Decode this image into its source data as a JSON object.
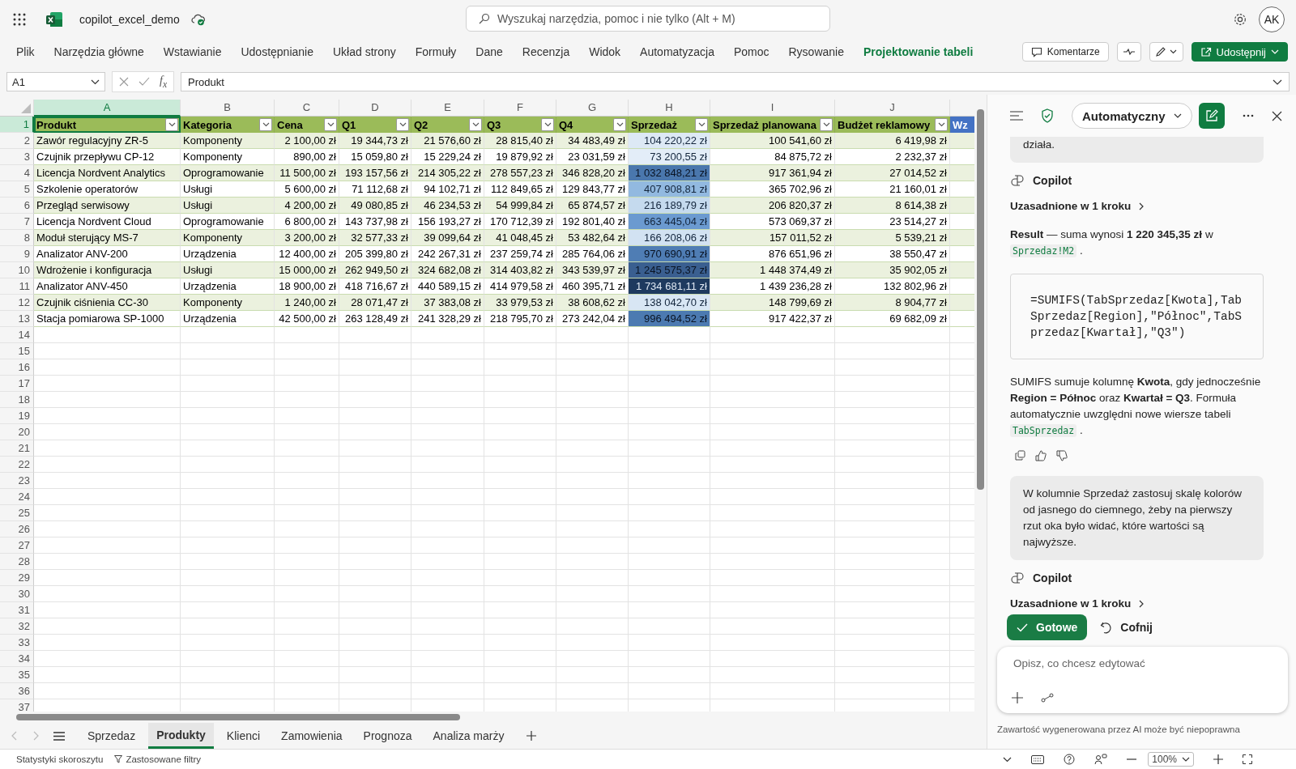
{
  "app": {
    "file_name": "copilot_excel_demo",
    "search_placeholder": "Wyszukaj narzędzia, pomoc i nie tylko (Alt + M)",
    "avatar": "AK"
  },
  "ribbon_tabs": [
    {
      "label": "Plik",
      "contextual": false
    },
    {
      "label": "Narzędzia główne",
      "contextual": false
    },
    {
      "label": "Wstawianie",
      "contextual": false
    },
    {
      "label": "Udostępnianie",
      "contextual": false
    },
    {
      "label": "Układ strony",
      "contextual": false
    },
    {
      "label": "Formuły",
      "contextual": false
    },
    {
      "label": "Dane",
      "contextual": false
    },
    {
      "label": "Recenzja",
      "contextual": false
    },
    {
      "label": "Widok",
      "contextual": false
    },
    {
      "label": "Automatyzacja",
      "contextual": false
    },
    {
      "label": "Pomoc",
      "contextual": false
    },
    {
      "label": "Rysowanie",
      "contextual": false
    },
    {
      "label": "Projektowanie tabeli",
      "contextual": true
    }
  ],
  "ribbon_buttons": {
    "comments": "Komentarze",
    "share": "Udostępnij"
  },
  "formula_bar": {
    "name_box": "A1",
    "function_label": "f$_{x}$",
    "value": "Produkt"
  },
  "sheet": {
    "columns": [
      {
        "label": "A",
        "selected": true
      },
      {
        "label": "B",
        "selected": false
      },
      {
        "label": "C",
        "selected": false
      },
      {
        "label": "D",
        "selected": false
      },
      {
        "label": "E",
        "selected": false
      },
      {
        "label": "F",
        "selected": false
      },
      {
        "label": "G",
        "selected": false
      },
      {
        "label": "H",
        "selected": false
      },
      {
        "label": "I",
        "selected": false
      },
      {
        "label": "J",
        "selected": false
      }
    ],
    "rows": [
      {
        "label": "1",
        "selected": true
      },
      {
        "label": "2",
        "selected": false
      },
      {
        "label": "3",
        "selected": false
      },
      {
        "label": "4",
        "selected": false
      },
      {
        "label": "5",
        "selected": false
      },
      {
        "label": "6",
        "selected": false
      },
      {
        "label": "7",
        "selected": false
      },
      {
        "label": "8",
        "selected": false
      },
      {
        "label": "9",
        "selected": false
      },
      {
        "label": "10",
        "selected": false
      },
      {
        "label": "11",
        "selected": false
      },
      {
        "label": "12",
        "selected": false
      },
      {
        "label": "13",
        "selected": false
      },
      {
        "label": "14",
        "selected": false
      },
      {
        "label": "15",
        "selected": false
      },
      {
        "label": "16",
        "selected": false
      },
      {
        "label": "17",
        "selected": false
      },
      {
        "label": "18",
        "selected": false
      },
      {
        "label": "19",
        "selected": false
      },
      {
        "label": "20",
        "selected": false
      },
      {
        "label": "21",
        "selected": false
      },
      {
        "label": "22",
        "selected": false
      },
      {
        "label": "23",
        "selected": false
      },
      {
        "label": "24",
        "selected": false
      },
      {
        "label": "25",
        "selected": false
      },
      {
        "label": "26",
        "selected": false
      },
      {
        "label": "27",
        "selected": false
      },
      {
        "label": "28",
        "selected": false
      },
      {
        "label": "29",
        "selected": false
      },
      {
        "label": "30",
        "selected": false
      },
      {
        "label": "31",
        "selected": false
      },
      {
        "label": "32",
        "selected": false
      },
      {
        "label": "33",
        "selected": false
      },
      {
        "label": "34",
        "selected": false
      },
      {
        "label": "35",
        "selected": false
      },
      {
        "label": "36",
        "selected": false
      },
      {
        "label": "37",
        "selected": false
      }
    ]
  },
  "table": {
    "headers": [
      {
        "label": "Produkt",
        "filter": true,
        "color": "#9bbb59"
      },
      {
        "label": "Kategoria",
        "filter": true,
        "color": "#9bbb59"
      },
      {
        "label": "Cena",
        "filter": true,
        "color": "#9bbb59"
      },
      {
        "label": "Q1",
        "filter": true,
        "color": "#9bbb59"
      },
      {
        "label": "Q2",
        "filter": true,
        "color": "#9bbb59"
      },
      {
        "label": "Q3",
        "filter": true,
        "color": "#9bbb59"
      },
      {
        "label": "Q4",
        "filter": true,
        "color": "#9bbb59"
      },
      {
        "label": "Sprzedaż",
        "filter": true,
        "color": "#9bbb59"
      },
      {
        "label": "Sprzedaż planowana",
        "filter": true,
        "color": "#9bbb59"
      },
      {
        "label": "Budżet reklamowy",
        "filter": true,
        "color": "#9bbb59"
      },
      {
        "label": "Wz",
        "filter": false,
        "color": "#4472c4"
      }
    ],
    "rows": [
      {
        "cells": [
          "Zawór regulacyjny ZR-5",
          "Komponenty",
          "2 100,00 zł",
          "19 344,73 zł",
          "21 576,60 zł",
          "28 815,40 zł",
          "34 483,49 zł",
          "104 220,22 zł",
          "100 541,60 zł",
          "6 419,98 zł"
        ],
        "color": "#dde9f5"
      },
      {
        "cells": [
          "Czujnik przepływu CP-12",
          "Komponenty",
          "890,00 zł",
          "15 059,80 zł",
          "15 229,24 zł",
          "19 879,92 zł",
          "23 031,59 zł",
          "73 200,55 zł",
          "84 875,72 zł",
          "2 232,37 zł"
        ],
        "color": "#e3edf8"
      },
      {
        "cells": [
          "Licencja Nordvent Analytics",
          "Oprogramowanie",
          "11 500,00 zł",
          "193 157,56 zł",
          "214 305,22 zł",
          "278 557,23 zł",
          "346 828,20 zł",
          "1 032 848,21 zł",
          "917 361,94 zł",
          "27 014,52 zł"
        ],
        "color": "#4a77ad"
      },
      {
        "cells": [
          "Szkolenie operatorów",
          "Usługi",
          "5 600,00 zł",
          "71 112,68 zł",
          "94 102,71 zł",
          "112 849,65 zł",
          "129 843,77 zł",
          "407 908,81 zł",
          "365 702,96 zł",
          "21 160,01 zł"
        ],
        "color": "#92b9e0"
      },
      {
        "cells": [
          "Przegląd serwisowy",
          "Usługi",
          "4 200,00 zł",
          "49 080,85 zł",
          "46 234,53 zł",
          "54 999,84 zł",
          "65 874,57 zł",
          "216 189,79 zł",
          "206 820,37 zł",
          "8 614,38 zł"
        ],
        "color": "#c5daee"
      },
      {
        "cells": [
          "Licencja Nordvent Cloud",
          "Oprogramowanie",
          "6 800,00 zł",
          "143 737,98 zł",
          "156 193,27 zł",
          "170 712,39 zł",
          "192 801,40 zł",
          "663 445,04 zł",
          "573 069,37 zł",
          "23 514,27 zł"
        ],
        "color": "#6b9ad0"
      },
      {
        "cells": [
          "Moduł sterujący MS-7",
          "Komponenty",
          "3 200,00 zł",
          "32 577,33 zł",
          "39 099,64 zł",
          "41 048,45 zł",
          "53 482,64 zł",
          "166 208,06 zł",
          "157 011,52 zł",
          "5 539,21 zł"
        ],
        "color": "#d2e2f2"
      },
      {
        "cells": [
          "Analizator ANV-200",
          "Urządzenia",
          "12 400,00 zł",
          "205 399,80 zł",
          "242 267,31 zł",
          "237 259,74 zł",
          "285 764,06 zł",
          "970 690,91 zł",
          "876 651,96 zł",
          "38 550,47 zł"
        ],
        "color": "#4f7db4"
      },
      {
        "cells": [
          "Wdrożenie i konfiguracja",
          "Usługi",
          "15 000,00 zł",
          "262 949,50 zł",
          "324 682,08 zł",
          "314 403,82 zł",
          "343 539,97 zł",
          "1 245 575,37 zł",
          "1 448 374,49 zł",
          "35 902,05 zł"
        ],
        "color": "#3a5f90"
      },
      {
        "cells": [
          "Analizator ANV-450",
          "Urządzenia",
          "18 900,00 zł",
          "418 716,67 zł",
          "440 589,15 zł",
          "414 979,58 zł",
          "460 395,71 zł",
          "1 734 681,11 zł",
          "1 439 236,28 zł",
          "132 802,96 zł"
        ],
        "color": "#1e3a5f"
      },
      {
        "cells": [
          "Czujnik ciśnienia CC-30",
          "Komponenty",
          "1 240,00 zł",
          "28 071,47 zł",
          "37 383,08 zł",
          "33 979,53 zł",
          "38 608,62 zł",
          "138 042,70 zł",
          "148 799,69 zł",
          "8 904,77 zł"
        ],
        "color": "#d8e6f4"
      },
      {
        "cells": [
          "Stacja pomiarowa SP-1000",
          "Urządzenia",
          "42 500,00 zł",
          "263 128,49 zł",
          "241 328,29 zł",
          "218 795,70 zł",
          "273 242,04 zł",
          "996 494,52 zł",
          "917 422,37 zł",
          "69 682,09 zł"
        ],
        "color": "#4c7ab1"
      }
    ]
  },
  "sheet_tabs": [
    {
      "label": "Sprzedaz",
      "selected": false
    },
    {
      "label": "Produkty",
      "selected": true
    },
    {
      "label": "Klienci",
      "selected": false
    },
    {
      "label": "Zamowienia",
      "selected": false
    },
    {
      "label": "Prognoza",
      "selected": false
    },
    {
      "label": "Analiza marży",
      "selected": false
    }
  ],
  "status_bar": {
    "workbook_stats": "Statystyki skoroszytu",
    "filters": "Zastosowane filtry",
    "zoom": "100%"
  },
  "copilot": {
    "mode": "Automatyczny",
    "messages": [
      {
        "kind": "user",
        "text": "działa."
      },
      {
        "kind": "author",
        "text": "Copilot"
      },
      {
        "kind": "steps",
        "text": "Uzasadnione w 1 kroku"
      },
      {
        "kind": "paragraph",
        "parts": [
          {
            "kind": "text",
            "text": "**Result** — suma wynosi **1 220 345,35 zł** w "
          },
          {
            "kind": "code",
            "text": "Sprzedaz!M2"
          },
          {
            "kind": "text",
            "text": " ."
          }
        ]
      },
      {
        "kind": "code_block",
        "text": "=SUMIFS(TabSprzedaz[Kwota],TabSprzedaz[Region],\"Północ\",TabSprzedaz[Kwartał],\"Q3\")"
      },
      {
        "kind": "paragraph",
        "parts": [
          {
            "kind": "text",
            "text": "SUMIFS sumuje kolumnę **Kwota**, gdy jednocześnie **Region = Północ** oraz **Kwartał = Q3**. Formuła automatycznie uwzględni nowe wiersze tabeli "
          },
          {
            "kind": "code",
            "text": "TabSprzedaz"
          },
          {
            "kind": "text",
            "text": " ."
          }
        ]
      },
      {
        "kind": "feedback"
      },
      {
        "kind": "user",
        "text": "W kolumnie Sprzedaż zastosuj skalę kolorów od jasnego do ciemnego, żeby na pierwszy rzut oka było widać, które wartości są najwyższe."
      },
      {
        "kind": "author",
        "text": "Copilot"
      },
      {
        "kind": "steps",
        "text": "Uzasadnione w 1 kroku"
      },
      {
        "kind": "actions",
        "confirm": "Gotowe",
        "undo": "Cofnij"
      }
    ],
    "input_placeholder": "Opisz, co chcesz edytować",
    "disclaimer": "Zawartość wygenerowana przez AI może być niepoprawna"
  }
}
